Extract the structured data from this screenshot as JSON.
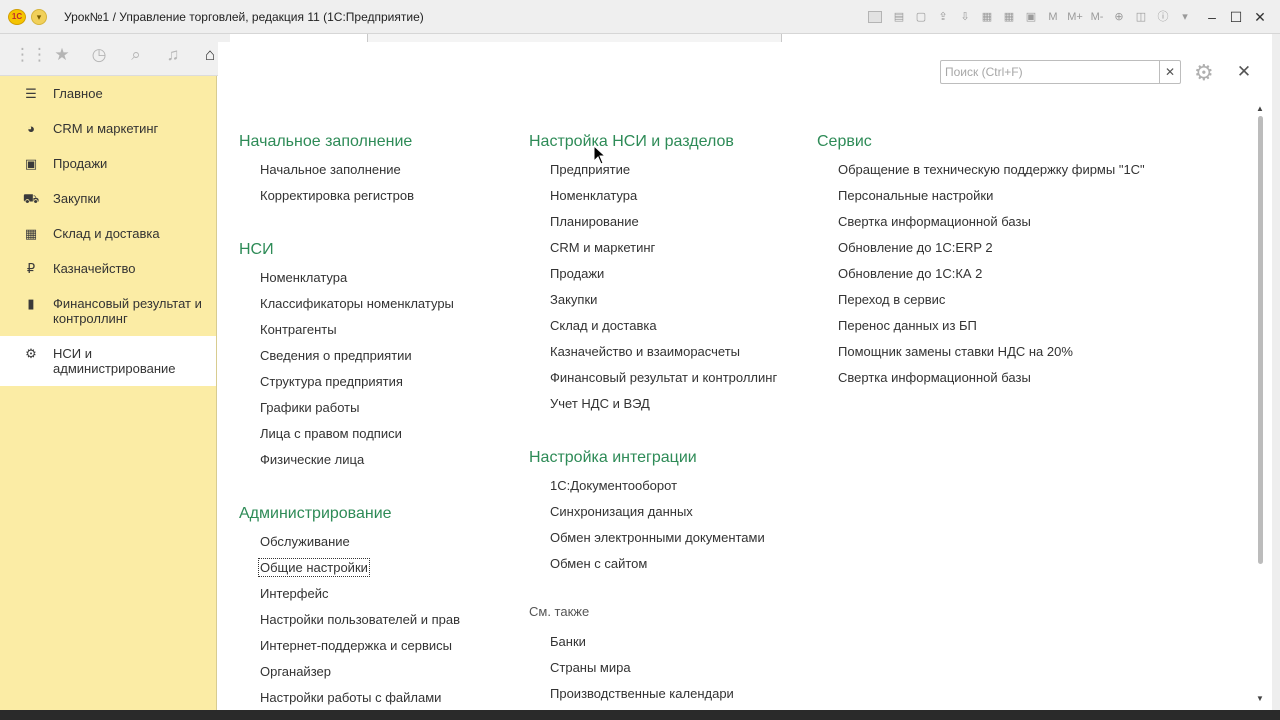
{
  "window": {
    "title": "Урок№1 / Управление торговлей, редакция 11  (1С:Предприятие)",
    "logo_text": "1С"
  },
  "search": {
    "placeholder": "Поиск (Ctrl+F)",
    "value": ""
  },
  "sidebar": {
    "items": [
      {
        "label": "Главное",
        "icon": "menu-icon",
        "active": false
      },
      {
        "label": "CRM и маркетинг",
        "icon": "pie-chart-icon",
        "active": false
      },
      {
        "label": "Продажи",
        "icon": "shopping-bag-icon",
        "active": false
      },
      {
        "label": "Закупки",
        "icon": "cart-icon",
        "active": false
      },
      {
        "label": "Склад и доставка",
        "icon": "warehouse-icon",
        "active": false
      },
      {
        "label": "Казначейство",
        "icon": "ruble-icon",
        "active": false
      },
      {
        "label": "Финансовый результат и контроллинг",
        "icon": "bar-chart-icon",
        "active": false
      },
      {
        "label": "НСИ и администрирование",
        "icon": "gear-icon",
        "active": true
      }
    ]
  },
  "columns": {
    "col1": {
      "sections": [
        {
          "title": "Начальное заполнение",
          "links": [
            "Начальное заполнение",
            "Корректировка регистров"
          ]
        },
        {
          "title": "НСИ",
          "links": [
            "Номенклатура",
            "Классификаторы номенклатуры",
            "Контрагенты",
            "Сведения о предприятии",
            "Структура предприятия",
            "Графики работы",
            "Лица с правом подписи",
            "Физические лица"
          ]
        },
        {
          "title": "Администрирование",
          "links": [
            "Обслуживание",
            "Общие настройки",
            "Интерфейс",
            "Настройки пользователей и прав",
            "Интернет-поддержка и сервисы",
            "Органайзер",
            "Настройки работы с файлами"
          ]
        }
      ]
    },
    "col2": {
      "sections": [
        {
          "title": "Настройка НСИ и разделов",
          "links": [
            "Предприятие",
            "Номенклатура",
            "Планирование",
            "CRM и маркетинг",
            "Продажи",
            "Закупки",
            "Склад и доставка",
            "Казначейство и взаиморасчеты",
            "Финансовый результат и контроллинг",
            "Учет НДС и ВЭД"
          ]
        },
        {
          "title": "Настройка интеграции",
          "links": [
            "1С:Документооборот",
            "Синхронизация данных",
            "Обмен электронными документами",
            "Обмен с сайтом"
          ]
        },
        {
          "title": "См. также",
          "links": [
            "Банки",
            "Страны мира",
            "Производственные календари"
          ]
        }
      ]
    },
    "col3": {
      "sections": [
        {
          "title": "Сервис",
          "links": [
            "Обращение в техническую поддержку фирмы \"1С\"",
            "Персональные настройки",
            "Свертка информационной базы",
            "Обновление до 1С:ERP 2",
            "Обновление до 1С:КА 2",
            "Переход в сервис",
            "Перенос данных из БП",
            "Помощник замены ставки НДС на 20%",
            "Свертка информационной базы"
          ]
        }
      ]
    }
  },
  "colors": {
    "section_title": "#2e8b57",
    "sidebar_bg": "#fbeca5"
  }
}
